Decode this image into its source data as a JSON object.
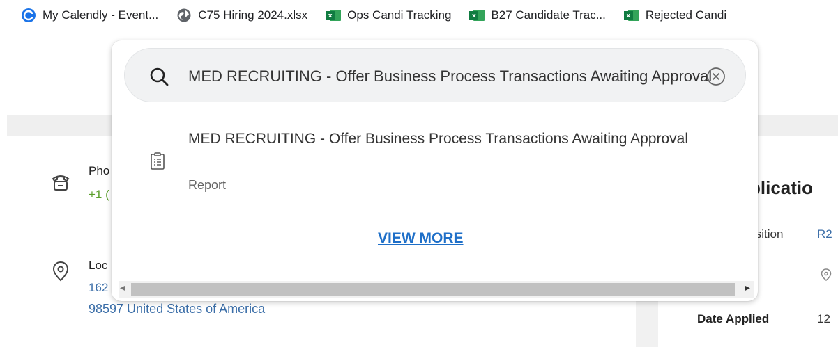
{
  "bookmarks": [
    {
      "label": "My Calendly - Event...",
      "icon": "calendly-icon"
    },
    {
      "label": "C75 Hiring 2024.xlsx",
      "icon": "globe-icon"
    },
    {
      "label": "Ops Candi Tracking",
      "icon": "excel-icon"
    },
    {
      "label": "B27 Candidate Trac...",
      "icon": "excel-icon"
    },
    {
      "label": "Rejected Candi",
      "icon": "excel-icon"
    }
  ],
  "excel_letter": "x",
  "search": {
    "query": "MED RECRUITING - Offer Business Process Transactions Awaiting Approval"
  },
  "result": {
    "title": "MED RECRUITING - Offer Business Process Transactions Awaiting Approval",
    "type": "Report",
    "icon": "report-clipboard-icon"
  },
  "view_more_label": "VIEW MORE",
  "background": {
    "phone_label": "Pho",
    "phone_value": "+1 (",
    "location_label": "Loc",
    "address_line1": "162",
    "address_line2": "98597 United States of America",
    "application_title": "plicatio",
    "requisition_label": "isition",
    "requisition_value": "R2",
    "date_applied_label": "Date Applied",
    "date_applied_value": "12"
  },
  "colors": {
    "link_blue": "#1e6fc8",
    "phone_green": "#5a9e2a",
    "excel_green": "#107c41"
  }
}
